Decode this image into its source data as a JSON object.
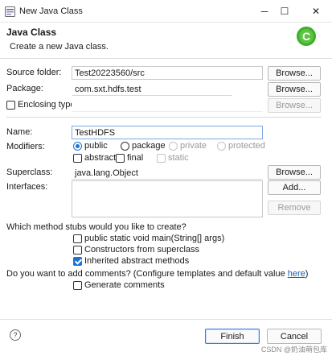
{
  "window": {
    "title": "New Java Class",
    "minimize_glyph": "─",
    "maximize_glyph": "☐",
    "close_glyph": "✕",
    "app_icon": "eclipse-java-icon"
  },
  "header": {
    "title": "Java Class",
    "description": "Create a new Java class.",
    "logo_icon": "new-class-wizard-icon",
    "logo_letter": "C"
  },
  "form": {
    "source_folder": {
      "label": "Source folder:",
      "value": "Test20223560/src",
      "button": "Browse..."
    },
    "package": {
      "label": "Package:",
      "value": "com.sxt.hdfs.test",
      "button": "Browse..."
    },
    "enclosing_type": {
      "label": "Enclosing type:",
      "value": "",
      "button": "Browse...",
      "checked": false
    },
    "name": {
      "label": "Name:",
      "value": "TestHDFS"
    },
    "modifiers": {
      "label": "Modifiers:",
      "public": "public",
      "package": "package",
      "private": "private",
      "protected": "protected",
      "abstract": "abstract",
      "final": "final",
      "static": "static",
      "selected": "public"
    },
    "superclass": {
      "label": "Superclass:",
      "value": "java.lang.Object",
      "button": "Browse..."
    },
    "interfaces": {
      "label": "Interfaces:",
      "add_button": "Add...",
      "remove_button": "Remove"
    }
  },
  "stubs": {
    "question": "Which method stubs would you like to create?",
    "main": "public static void main(String[] args)",
    "constructors": "Constructors from superclass",
    "inherited": "Inherited abstract methods"
  },
  "comments": {
    "question_prefix": "Do you want to add comments? (Configure templates and default value ",
    "link": "here",
    "question_suffix": ")",
    "generate": "Generate comments"
  },
  "footer": {
    "help_glyph": "?",
    "finish": "Finish",
    "cancel": "Cancel",
    "watermark": "CSDN @奶油萌包库"
  },
  "colors": {
    "accent": "#1973d8",
    "logo_green": "#3fae2a"
  }
}
